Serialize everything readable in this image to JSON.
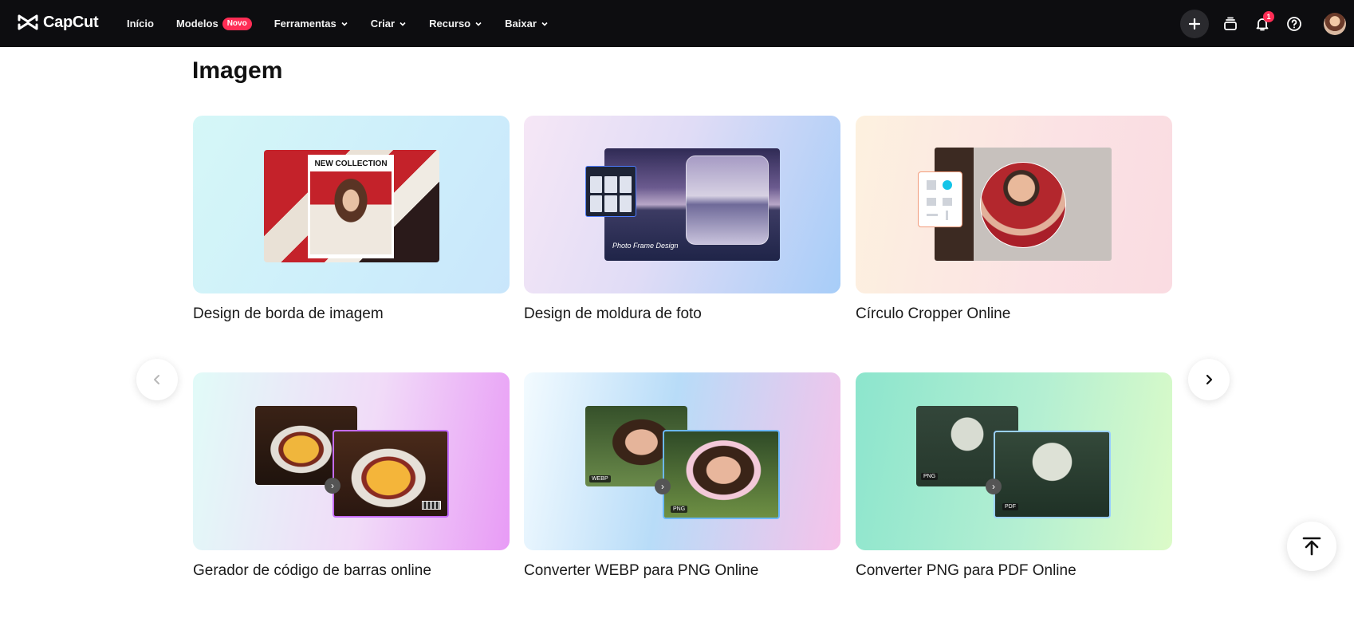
{
  "app": {
    "logo_text": "CapCut"
  },
  "nav": {
    "items": [
      {
        "label": "Início",
        "has_menu": false
      },
      {
        "label": "Modelos",
        "badge": "Novo",
        "has_menu": false
      },
      {
        "label": "Ferramentas",
        "has_menu": true
      },
      {
        "label": "Criar",
        "has_menu": true
      },
      {
        "label": "Recurso",
        "has_menu": true
      },
      {
        "label": "Baixar",
        "has_menu": true
      }
    ]
  },
  "toolbar": {
    "notification_count": "1",
    "icons": [
      "plus-icon",
      "layers-icon",
      "bell-icon",
      "help-icon"
    ]
  },
  "section": {
    "title": "Imagem",
    "cards": [
      {
        "caption": "Design de borda de imagem",
        "art_label": "NEW COLLECTION"
      },
      {
        "caption": "Design de moldura de foto",
        "art_label": "Photo Frame Design"
      },
      {
        "caption": "Círculo Cropper Online"
      },
      {
        "caption": "Gerador de código de barras online"
      },
      {
        "caption": "Converter WEBP para PNG Online",
        "tag_from": "WEBP",
        "tag_to": "PNG"
      },
      {
        "caption": "Converter PNG para PDF Online",
        "tag_from": "PNG",
        "tag_to": "PDF"
      }
    ]
  },
  "colors": {
    "topbar": "#0d0d10",
    "badge": "#ff2d55"
  }
}
